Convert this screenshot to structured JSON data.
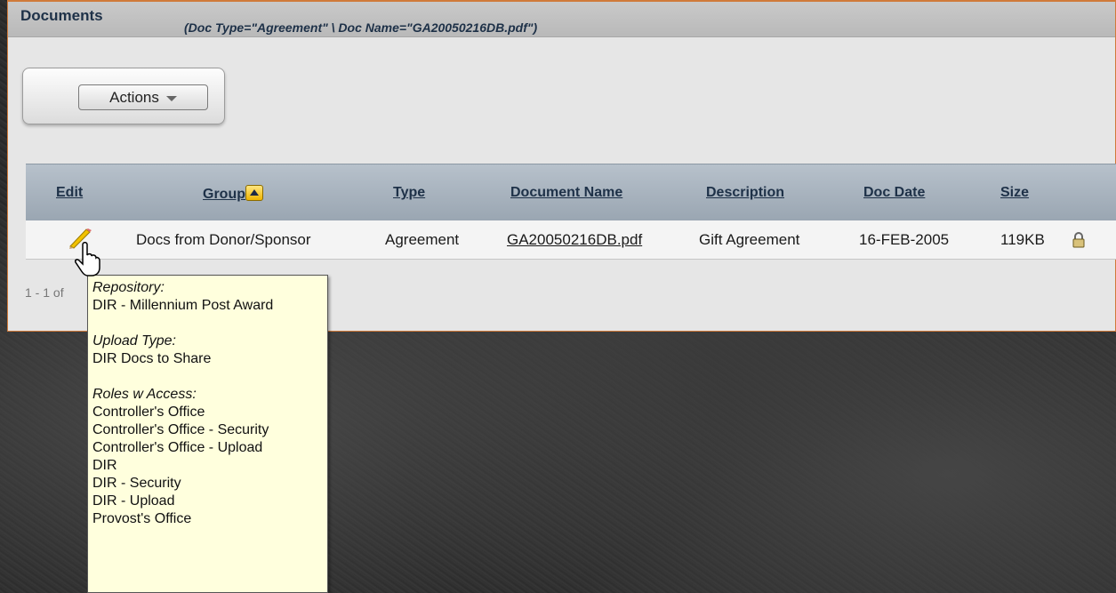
{
  "panel": {
    "title": "Documents",
    "filter": "(Doc Type=\"Agreement\" \\ Doc Name=\"GA20050216DB.pdf\")"
  },
  "actions": {
    "label": "Actions"
  },
  "grid": {
    "headers": {
      "edit": "Edit",
      "group": "Group",
      "type": "Type",
      "document_name": "Document Name",
      "description": "Description",
      "doc_date": "Doc Date",
      "size": "Size"
    },
    "rows": [
      {
        "group": "Docs from Donor/Sponsor",
        "type": "Agreement",
        "document_name": "GA20050216DB.pdf",
        "description": "Gift Agreement",
        "doc_date": "16-FEB-2005",
        "size": "119KB"
      }
    ],
    "pager": "1 - 1 of"
  },
  "tooltip": {
    "repository_label": "Repository:",
    "repository_value": "DIR - Millennium Post Award",
    "upload_type_label": "Upload Type:",
    "upload_type_value": "DIR Docs to Share",
    "roles_label": "Roles w Access:",
    "roles": [
      "Controller's Office",
      "Controller's Office - Security",
      "Controller's Office - Upload",
      "DIR",
      "DIR - Security",
      "DIR - Upload",
      "Provost's Office"
    ]
  },
  "icons": {
    "edit": "pencil-icon",
    "sort": "sort-ascending-icon",
    "lock": "lock-icon",
    "cursor": "hand-cursor-icon"
  },
  "colors": {
    "accent_border": "#d07a3a",
    "header_text": "#1e3148",
    "tooltip_bg": "#ffffdd"
  }
}
